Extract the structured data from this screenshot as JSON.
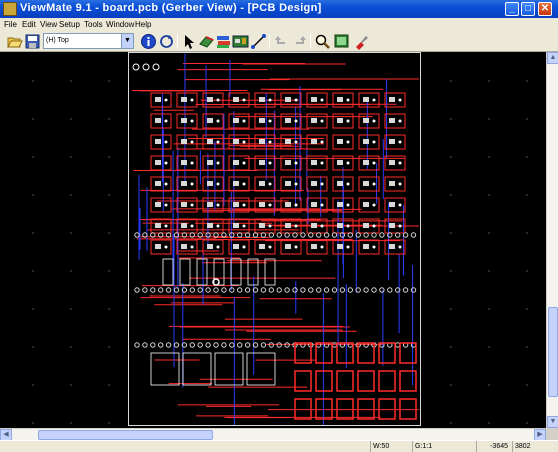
{
  "window": {
    "title": "ViewMate 9.1 - board.pcb (Gerber View) - [PCB Design]",
    "minimize_glyph": "_",
    "maximize_glyph": "□",
    "close_glyph": "✕"
  },
  "menu": {
    "items": [
      "File",
      "Edit",
      "View",
      "Setup",
      "Tools",
      "Window",
      "Help"
    ]
  },
  "toolbar": {
    "layer_value": "(H) Top",
    "icons": [
      "open-folder-icon",
      "save-icon",
      "info-icon",
      "refresh-icon",
      "select-arrow-icon",
      "view-3d-icon",
      "layers-icon",
      "board-icon",
      "route-icon",
      "undo-icon",
      "redo-icon",
      "zoom-icon",
      "screen-icon",
      "paint-icon"
    ]
  },
  "colors": {
    "trace_red": "#ff2a2a",
    "trace_blue": "#2a3cff",
    "pad_white": "#ffffff",
    "silk_gray": "#d8d8d8",
    "background": "#000000"
  },
  "status": {
    "w_label": "W:50",
    "g_label": "G:1:1",
    "x_coord": "-3645",
    "y_coord": "3802"
  }
}
